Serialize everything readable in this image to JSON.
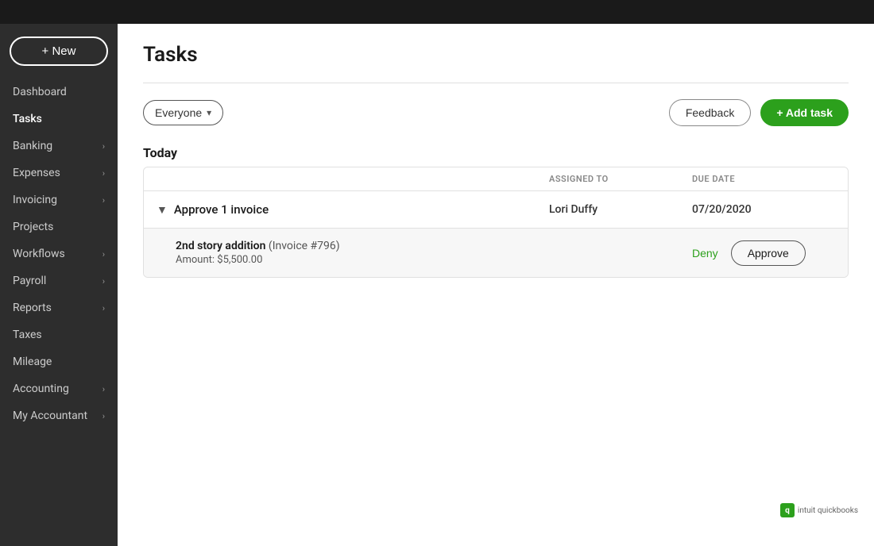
{
  "topbar": {
    "background": "#1a1a1a"
  },
  "sidebar": {
    "new_button_label": "+ New",
    "items": [
      {
        "label": "Dashboard",
        "has_arrow": false,
        "active": false
      },
      {
        "label": "Tasks",
        "has_arrow": false,
        "active": true
      },
      {
        "label": "Banking",
        "has_arrow": true,
        "active": false
      },
      {
        "label": "Expenses",
        "has_arrow": true,
        "active": false
      },
      {
        "label": "Invoicing",
        "has_arrow": true,
        "active": false
      },
      {
        "label": "Projects",
        "has_arrow": false,
        "active": false
      },
      {
        "label": "Workflows",
        "has_arrow": true,
        "active": false
      },
      {
        "label": "Payroll",
        "has_arrow": true,
        "active": false
      },
      {
        "label": "Reports",
        "has_arrow": true,
        "active": false
      },
      {
        "label": "Taxes",
        "has_arrow": false,
        "active": false
      },
      {
        "label": "Mileage",
        "has_arrow": false,
        "active": false
      },
      {
        "label": "Accounting",
        "has_arrow": true,
        "active": false
      },
      {
        "label": "My Accountant",
        "has_arrow": true,
        "active": false
      }
    ]
  },
  "main": {
    "title": "Tasks",
    "filter": {
      "label": "Everyone",
      "chevron": "▾"
    },
    "feedback_btn": "Feedback",
    "add_task_btn": "+ Add task",
    "section": {
      "today_label": "Today",
      "columns": {
        "assigned_to": "ASSIGNED TO",
        "due_date": "DUE DATE"
      },
      "task_group": {
        "label": "Approve 1 invoice",
        "assigned_to": "Lori Duffy",
        "due_date": "07/20/2020",
        "expand_icon": "▼"
      },
      "sub_item": {
        "title": "2nd story addition",
        "invoice_num": "(Invoice #796)",
        "amount": "Amount: $5,500.00",
        "deny_label": "Deny",
        "approve_label": "Approve"
      }
    }
  },
  "qb": {
    "logo_text": "intuit quickbooks"
  }
}
